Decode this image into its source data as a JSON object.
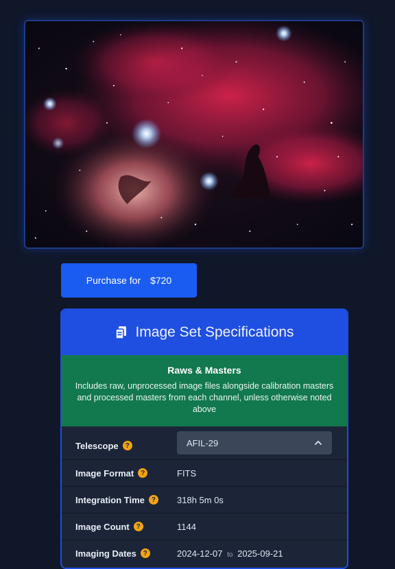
{
  "hero": {
    "alt": "Horsehead and Flame Nebula astrophotograph"
  },
  "purchase": {
    "label": "Purchase for",
    "price": "$720"
  },
  "specs": {
    "title": "Image Set Specifications",
    "banner_title": "Raws & Masters",
    "banner_text": "Includes raw, unprocessed image files alongside calibration masters and processed masters from each channel, unless otherwise noted above",
    "telescope_label": "Telescope",
    "telescope_value": "AFIL-29",
    "format_label": "Image Format",
    "format_value": "FITS",
    "integration_label": "Integration Time",
    "integration_value": "318h 5m 0s",
    "count_label": "Image Count",
    "count_value": "1144",
    "dates_label": "Imaging Dates",
    "dates_start": "2024-12-07",
    "dates_to": "to",
    "dates_end": "2025-09-21",
    "help_glyph": "?"
  },
  "colors": {
    "accent": "#1a5cf2",
    "card_head": "#1f4fe0",
    "banner": "#12784d",
    "help": "#f2a413"
  }
}
